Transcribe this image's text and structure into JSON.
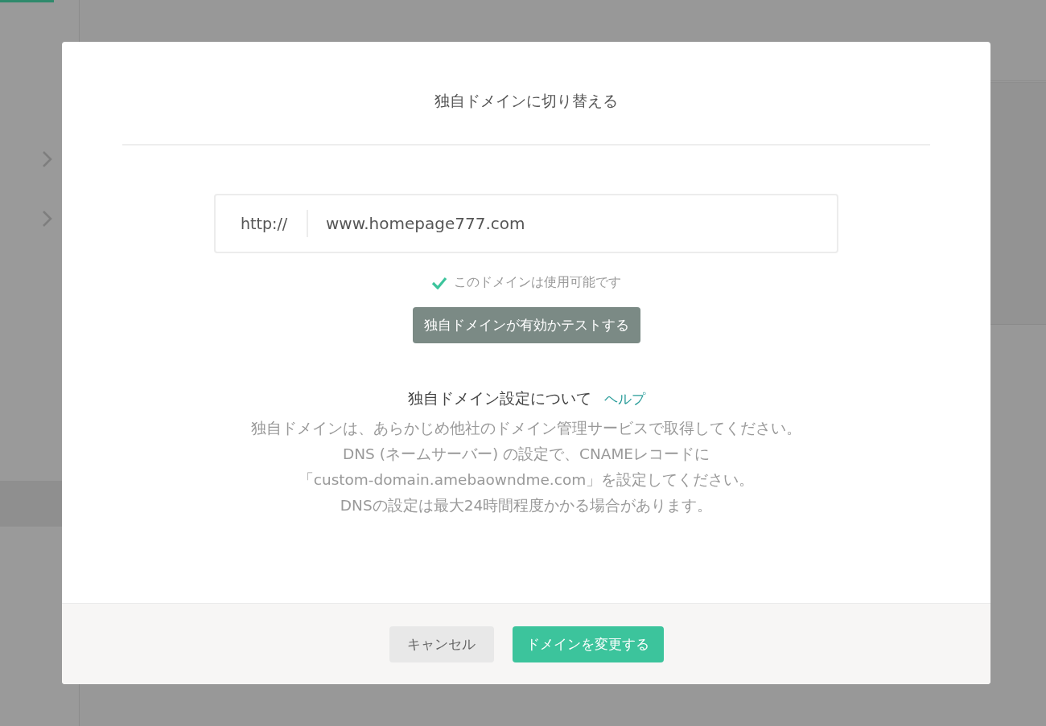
{
  "dialog": {
    "title": "独自ドメインに切り替える",
    "domain_field": {
      "prefix": "http://",
      "value": "www.homepage777.com"
    },
    "availability": {
      "available": true,
      "text": "このドメインは使用可能です"
    },
    "test_button": "独自ドメインが有効かテストする",
    "help": {
      "heading": "独自ドメイン設定について",
      "link": "ヘルプ"
    },
    "instructions": [
      "独自ドメインは、あらかじめ他社のドメイン管理サービスで取得してください。",
      "DNS (ネームサーバー) の設定で、CNAMEレコードに",
      "「custom-domain.amebaowndme.com」を設定してください。",
      "DNSの設定は最大24時間程度かかる場合があります。"
    ],
    "buttons": [
      {
        "label": "キャンセル",
        "kind": "secondary"
      },
      {
        "label": "ドメインを変更する",
        "kind": "primary"
      }
    ]
  }
}
